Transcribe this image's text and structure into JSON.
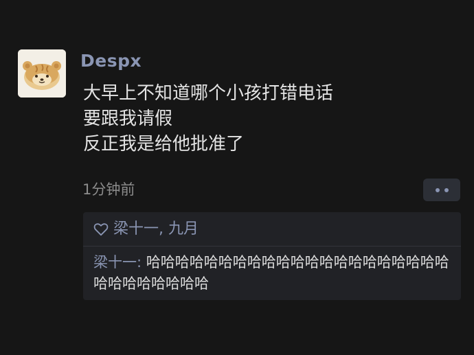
{
  "post": {
    "username": "Despx",
    "lines": [
      "大早上不知道哪个小孩打错电话",
      "要跟我请假",
      "反正我是给他批准了"
    ],
    "timestamp": "1分钟前"
  },
  "likes": {
    "icon": "heart-icon",
    "names": "梁十一, 九月"
  },
  "comment": {
    "author": "梁十一",
    "separator": ": ",
    "text": "哈哈哈哈哈哈哈哈哈哈哈哈哈哈哈哈哈哈哈哈哈哈哈哈哈哈哈哈哈"
  },
  "colors": {
    "background": "#161616",
    "name_accent": "#8a95b3",
    "box": "#212226"
  }
}
